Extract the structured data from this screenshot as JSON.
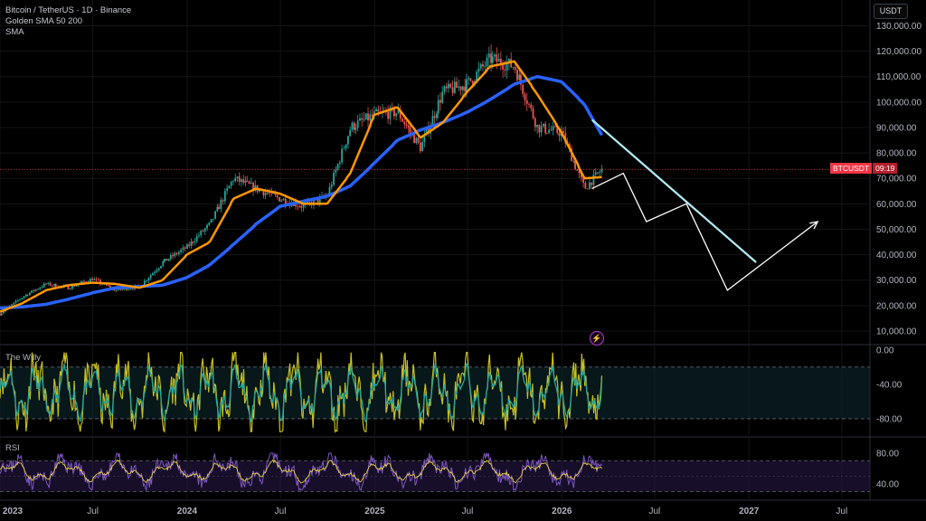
{
  "header": {
    "title": "Bitcoin / TetherUS · 1D · Binance",
    "indicator_1": "Golden SMA 50 200",
    "indicator_2": "SMA",
    "currency_button": "USDT"
  },
  "price_tag": {
    "symbol": "BTCUSDT",
    "countdown": "09:19"
  },
  "panes": {
    "willy_title": "The Willy",
    "rsi_title": "RSI"
  },
  "icons": {
    "alert": "lightning-icon"
  },
  "colors": {
    "background": "#000000",
    "candle_up": "#26a69a",
    "candle_down": "#ef5350",
    "sma_fast": "#ff9800",
    "sma_slow": "#2962ff",
    "projection_trend": "#b2ebf2",
    "projection_path": "#ffffff",
    "current_price_line": "#f23645",
    "willy_line": "#c8c020",
    "willy_signal": "#26a69a",
    "rsi_line": "#7e57c2",
    "rsi_signal": "#ffeb3b"
  },
  "chart_data": [
    {
      "type": "line",
      "title": "Bitcoin / TetherUS · 1D · Binance",
      "x_ticks": [
        "2023",
        "Jul",
        "2024",
        "Jul",
        "2025",
        "Jul",
        "2026",
        "Jul",
        "2027",
        "Jul"
      ],
      "y_ticks": [
        "130,000.00",
        "120,000.00",
        "110,000.00",
        "100,000.00",
        "90,000.00",
        "80,000.00",
        "70,000.00",
        "60,000.00",
        "50,000.00",
        "40,000.00",
        "30,000.00",
        "20,000.00",
        "10,000.00"
      ],
      "ylim": [
        5000,
        133000
      ],
      "price_scale": "linear",
      "dates": [
        "2023-01-01",
        "2023-02-15",
        "2023-04-01",
        "2023-05-15",
        "2023-07-01",
        "2023-08-15",
        "2023-10-01",
        "2023-11-15",
        "2024-01-01",
        "2024-02-15",
        "2024-04-01",
        "2024-05-15",
        "2024-07-01",
        "2024-08-15",
        "2024-10-01",
        "2024-11-15",
        "2025-01-01",
        "2025-02-15",
        "2025-04-01",
        "2025-05-15",
        "2025-07-01",
        "2025-08-15",
        "2025-10-01",
        "2025-11-15",
        "2026-01-01",
        "2026-02-15",
        "2026-03-20"
      ],
      "series": [
        {
          "name": "BTCUSDT",
          "values": [
            16600,
            23500,
            28500,
            27000,
            30500,
            26000,
            27500,
            37000,
            43000,
            52000,
            70000,
            66000,
            62000,
            59000,
            63000,
            90000,
            95000,
            96000,
            82000,
            104000,
            107000,
            117000,
            114000,
            90000,
            88000,
            66000,
            73500
          ]
        },
        {
          "name": "SMA 50",
          "values": [
            17500,
            21000,
            26000,
            28000,
            29000,
            28500,
            27000,
            30000,
            40000,
            45000,
            62000,
            66000,
            64000,
            60000,
            60000,
            72000,
            95000,
            98000,
            86000,
            92000,
            104000,
            114000,
            116000,
            103000,
            88000,
            70000,
            70500
          ]
        },
        {
          "name": "SMA 200",
          "values": [
            19000,
            19500,
            20500,
            22500,
            25000,
            27000,
            27500,
            28000,
            31000,
            36000,
            44000,
            52000,
            59000,
            61000,
            63000,
            67000,
            76000,
            85000,
            89000,
            92000,
            96000,
            101000,
            107000,
            110000,
            108000,
            99000,
            87000
          ]
        }
      ],
      "projection": {
        "trend_line": [
          [
            "2026-03-01",
            93000
          ],
          [
            "2027-01-15",
            37000
          ]
        ],
        "path": [
          [
            "2026-03-01",
            66000
          ],
          [
            "2026-05-01",
            72000
          ],
          [
            "2026-06-15",
            53000
          ],
          [
            "2026-09-01",
            60000
          ],
          [
            "2026-11-20",
            26000
          ],
          [
            "2027-05-15",
            53000
          ]
        ]
      },
      "current_price": 73500
    },
    {
      "type": "line",
      "title": "The Willy",
      "y_ticks": [
        "0.00",
        "-40.00",
        "-80.00"
      ],
      "ylim": [
        -100,
        5
      ],
      "bands": [
        -20,
        -80
      ],
      "series": [
        {
          "name": "The Willy"
        },
        {
          "name": "Signal"
        }
      ],
      "range": [
        -95,
        -3
      ],
      "last_value": -30
    },
    {
      "type": "line",
      "title": "RSI",
      "y_ticks": [
        "80.00",
        "40.00"
      ],
      "ylim": [
        20,
        100
      ],
      "bands": [
        70,
        30
      ],
      "series": [
        {
          "name": "RSI"
        },
        {
          "name": "RSI-based MA"
        }
      ],
      "range": [
        28,
        88
      ],
      "last_value": 64
    }
  ]
}
